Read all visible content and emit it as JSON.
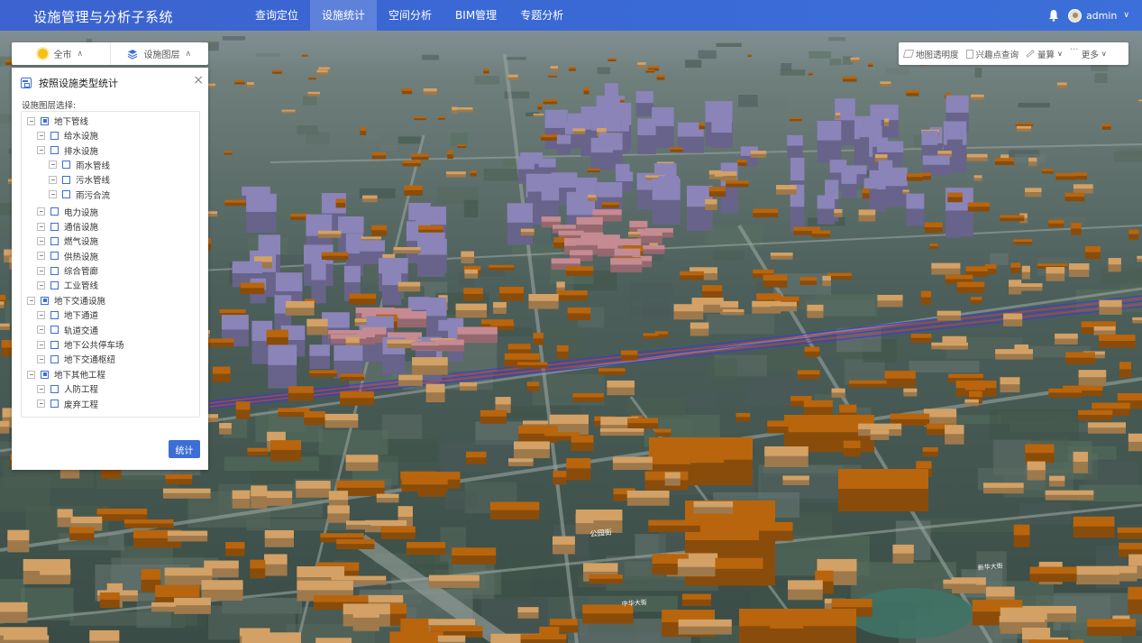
{
  "app": {
    "title": "设施管理与分析子系统"
  },
  "nav": [
    {
      "label": "查询定位",
      "active": false
    },
    {
      "label": "设施统计",
      "active": true
    },
    {
      "label": "空间分析",
      "active": false
    },
    {
      "label": "BIM管理",
      "active": false
    },
    {
      "label": "专题分析",
      "active": false
    }
  ],
  "user": {
    "name": "admin",
    "bell_icon": "bell-icon"
  },
  "selector": {
    "region": "全市",
    "layer": "设施图层"
  },
  "panel": {
    "title": "按照设施类型统计",
    "layer_label": "设施图层选择:",
    "tree": [
      {
        "label": "地下管线",
        "level": 0,
        "state": "partial"
      },
      {
        "label": "给水设施",
        "level": 1,
        "state": "unchecked"
      },
      {
        "label": "排水设施",
        "level": 1,
        "state": "unchecked"
      },
      {
        "label": "雨水管线",
        "level": 2,
        "state": "unchecked"
      },
      {
        "label": "污水管线",
        "level": 2,
        "state": "unchecked"
      },
      {
        "label": "雨污合流",
        "level": 2,
        "state": "unchecked"
      },
      {
        "label": "电力设施",
        "level": 1,
        "state": "unchecked"
      },
      {
        "label": "通信设施",
        "level": 1,
        "state": "unchecked"
      },
      {
        "label": "燃气设施",
        "level": 1,
        "state": "unchecked"
      },
      {
        "label": "供热设施",
        "level": 1,
        "state": "unchecked"
      },
      {
        "label": "综合管廊",
        "level": 1,
        "state": "unchecked"
      },
      {
        "label": "工业管线",
        "level": 1,
        "state": "unchecked"
      },
      {
        "label": "地下交通设施",
        "level": 0,
        "state": "partial"
      },
      {
        "label": "地下通道",
        "level": 1,
        "state": "unchecked"
      },
      {
        "label": "轨道交通",
        "level": 1,
        "state": "unchecked"
      },
      {
        "label": "地下公共停车场",
        "level": 1,
        "state": "unchecked"
      },
      {
        "label": "地下交通枢纽",
        "level": 1,
        "state": "unchecked"
      },
      {
        "label": "地下其他工程",
        "level": 0,
        "state": "partial"
      },
      {
        "label": "人防工程",
        "level": 1,
        "state": "unchecked"
      },
      {
        "label": "废弃工程",
        "level": 1,
        "state": "unchecked"
      }
    ],
    "submit_label": "统计"
  },
  "tools": [
    {
      "label": "地图透明度",
      "icon": "layers-icon"
    },
    {
      "label": "兴趣点查询",
      "icon": "poi-icon"
    },
    {
      "label": "量算",
      "icon": "ruler-icon",
      "dropdown": true
    },
    {
      "label": "更多",
      "icon": "more-icon",
      "dropdown": true
    }
  ],
  "map": {
    "road_labels": [
      "公园街",
      "新华大街",
      "中华大街"
    ],
    "colors": {
      "satellite_ground": "#3d5552",
      "building_orange": "#b8650d",
      "building_tan": "#d3a165",
      "building_purple": "#8a84b8",
      "building_pink": "#c58a92",
      "pipeline_blue": "#3b3dd6",
      "pipeline_red": "#c83a5a",
      "accent": "#3b6fd7"
    }
  }
}
